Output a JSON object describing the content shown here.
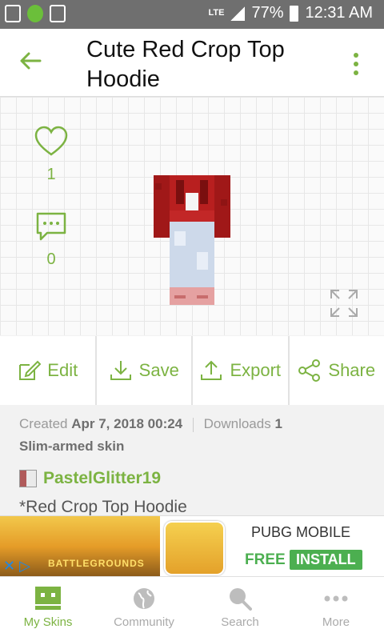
{
  "status_bar": {
    "network": "LTE",
    "battery": "77%",
    "time": "12:31 AM"
  },
  "header": {
    "title": "Cute Red Crop Top Hoodie"
  },
  "stats": {
    "likes": "1",
    "comments": "0"
  },
  "actions": [
    {
      "label": "Edit",
      "icon": "edit-icon"
    },
    {
      "label": "Save",
      "icon": "download-icon"
    },
    {
      "label": "Export",
      "icon": "upload-icon"
    },
    {
      "label": "Share",
      "icon": "share-icon"
    }
  ],
  "info": {
    "created_label": "Created",
    "created_value": "Apr 7, 2018 00:24",
    "downloads_label": "Downloads",
    "downloads_value": "1",
    "skin_type": "Slim-armed skin"
  },
  "author": {
    "name": "PastelGlitter19"
  },
  "description": "*Red Crop Top Hoodie",
  "ad": {
    "app_name": "PUBG MOBILE",
    "free_label": "FREE",
    "install_label": "INSTALL",
    "game_text": "BATTLEGROUNDS"
  },
  "bottom_nav": [
    {
      "label": "My Skins",
      "active": true
    },
    {
      "label": "Community",
      "active": false
    },
    {
      "label": "Search",
      "active": false
    },
    {
      "label": "More",
      "active": false
    }
  ],
  "colors": {
    "accent": "#7cb342",
    "status_bar": "#6f6f6f"
  }
}
